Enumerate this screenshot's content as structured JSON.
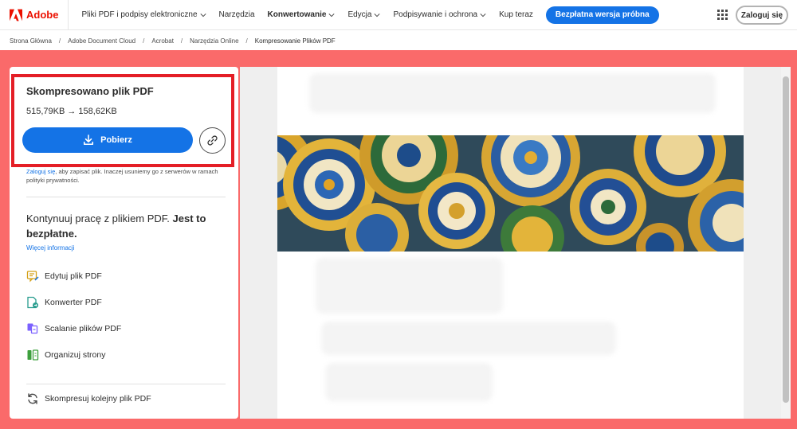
{
  "brand": {
    "name": "Adobe",
    "color": "#eb1000"
  },
  "nav": {
    "items": [
      {
        "label": "Pliki PDF i podpisy elektroniczne",
        "dropdown": true,
        "active": false
      },
      {
        "label": "Narzędzia",
        "dropdown": false,
        "active": false
      },
      {
        "label": "Konwertowanie",
        "dropdown": true,
        "active": true
      },
      {
        "label": "Edycja",
        "dropdown": true,
        "active": false
      },
      {
        "label": "Podpisywanie i ochrona",
        "dropdown": true,
        "active": false
      },
      {
        "label": "Kup teraz",
        "dropdown": false,
        "active": false
      }
    ],
    "trial_button": "Bezpłatna wersja próbna",
    "login_button": "Zaloguj się"
  },
  "breadcrumb": [
    "Strona Główna",
    "Adobe Document Cloud",
    "Acrobat",
    "Narzędzia Online",
    "Kompresowanie Plików PDF"
  ],
  "result": {
    "title": "Skompresowano plik PDF",
    "size_text": "515,79KB → 158,62KB",
    "download_label": "Pobierz",
    "notice_link": "Zaloguj się",
    "notice_text": ", aby zapisać plik. Inaczej usuniemy go z serwerów w ramach polityki prywatności."
  },
  "continue": {
    "text": "Kontynuuj pracę z plikiem PDF. ",
    "bold": "Jest to bezpłatne.",
    "more_info": "Więcej informacji"
  },
  "tools": [
    {
      "label": "Edytuj plik PDF",
      "icon": "edit-pdf-icon"
    },
    {
      "label": "Konwerter PDF",
      "icon": "convert-pdf-icon"
    },
    {
      "label": "Scalanie plików PDF",
      "icon": "merge-pdf-icon"
    },
    {
      "label": "Organizuj strony",
      "icon": "organize-pages-icon"
    }
  ],
  "compress_again": {
    "label": "Skompresuj kolejny plik PDF",
    "icon": "refresh-icon"
  },
  "colors": {
    "accent": "#1473e6",
    "background": "#fa6a6a",
    "highlight": "#e41e26"
  }
}
